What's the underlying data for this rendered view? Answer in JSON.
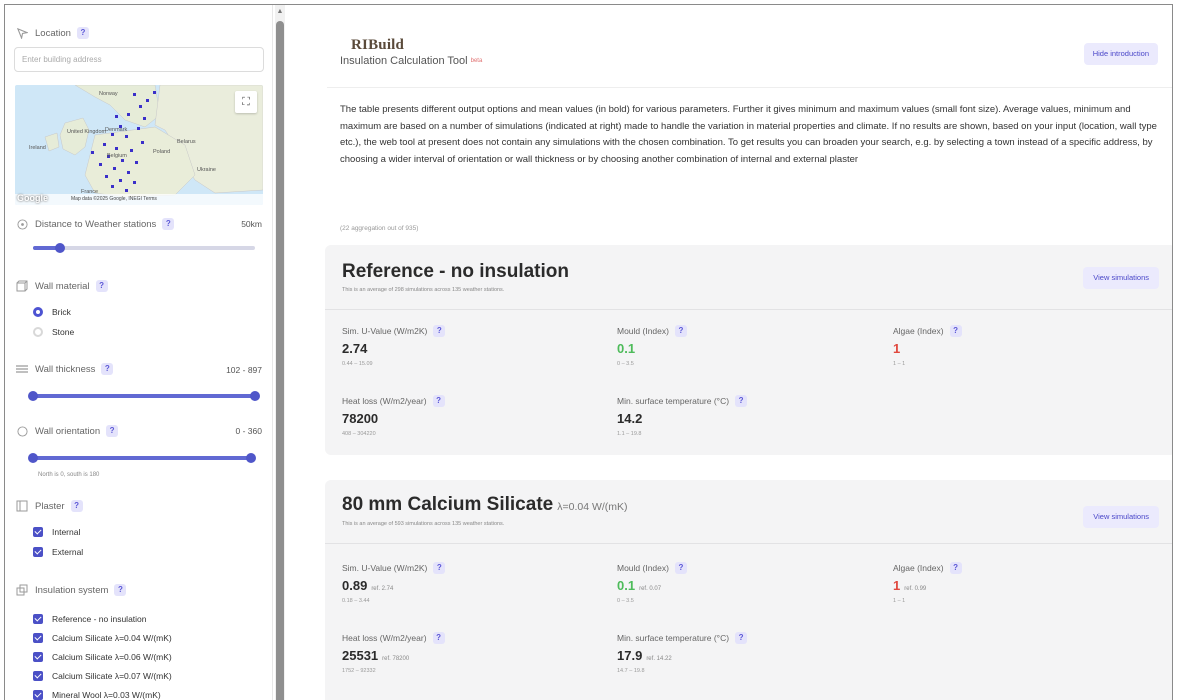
{
  "sidebar": {
    "location": {
      "label": "Location",
      "help": "?",
      "placeholder": "Enter building address"
    },
    "map": {
      "attribution": "Map data ©2025 Google, INEGI   Terms",
      "google": "Google",
      "labels": [
        "Norway",
        "United Kingdom",
        "Ireland",
        "Denmark",
        "Poland",
        "Belarus",
        "Ukraine",
        "France",
        "Belgium"
      ]
    },
    "distance": {
      "label": "Distance to Weather stations",
      "help": "?",
      "value": "50km",
      "fraction": 0.12
    },
    "wall_material": {
      "label": "Wall material",
      "help": "?",
      "options": [
        {
          "label": "Brick",
          "selected": true
        },
        {
          "label": "Stone",
          "selected": false
        }
      ]
    },
    "wall_thickness": {
      "label": "Wall thickness",
      "help": "?",
      "value": "102 - 897",
      "min_fraction": 0.0,
      "max_fraction": 1.0
    },
    "wall_orientation": {
      "label": "Wall orientation",
      "help": "?",
      "value": "0 - 360",
      "hint": "North is 0, south is 180",
      "min_fraction": 0.0,
      "max_fraction": 1.0
    },
    "plaster": {
      "label": "Plaster",
      "help": "?",
      "options": [
        {
          "label": "Internal"
        },
        {
          "label": "External"
        }
      ]
    },
    "insulation": {
      "label": "Insulation system",
      "help": "?",
      "options": [
        {
          "label": "Reference - no insulation"
        },
        {
          "label": "Calcium Silicate λ=0.04 W/(mK)"
        },
        {
          "label": "Calcium Silicate λ=0.06 W/(mK)"
        },
        {
          "label": "Calcium Silicate λ=0.07 W/(mK)"
        },
        {
          "label": "Mineral Wool λ=0.03 W/(mK)"
        }
      ]
    }
  },
  "header": {
    "logo": "RIBuild",
    "title": "Insulation Calculation Tool",
    "beta": "beta",
    "hide_intro": "Hide introduction"
  },
  "intro_text": "The table presents different output options and mean values (in bold) for various parameters. Further it gives minimum and maximum values (small font size). Average values, minimum and maximum are based on a number of simulations (indicated at right) made to handle the variation in material properties and climate. If no results are shown, based on your input (location, wall type etc.), the web tool at present does not contain any simulations with the chosen combination. To get results you can broaden your search, e.g. by selecting a town instead of a specific address, by choosing a wider interval of orientation or wall thickness or by choosing another combination of internal and external plaster",
  "aggregation": "(22 aggregation out of 935)",
  "cards": [
    {
      "title": "Reference - no insulation",
      "lambda": "",
      "subtitle": "This is an average of 298 simulations across 135 weather stations.",
      "button": "View simulations",
      "metrics": [
        {
          "label": "Sim. U-Value (W/m2K)",
          "value": "2.74",
          "ref": "",
          "range": "0.44 – 15.09",
          "color": "default"
        },
        {
          "label": "Mould (Index)",
          "value": "0.1",
          "ref": "",
          "range": "0 – 3.5",
          "color": "green"
        },
        {
          "label": "Algae (Index)",
          "value": "1",
          "ref": "",
          "range": "1 – 1",
          "color": "red"
        },
        {
          "label": "Heat loss (W/m2/year)",
          "value": "78200",
          "ref": "",
          "range": "408 – 304220",
          "color": "default"
        },
        {
          "label": "Min. surface temperature (°C)",
          "value": "14.2",
          "ref": "",
          "range": "1.1 – 19.8",
          "color": "default"
        }
      ]
    },
    {
      "title": "80 mm Calcium Silicate",
      "lambda": "λ=0.04 W/(mK)",
      "subtitle": "This is an average of 593 simulations across 135 weather stations.",
      "button": "View simulations",
      "metrics": [
        {
          "label": "Sim. U-Value (W/m2K)",
          "value": "0.89",
          "ref": "ref. 2.74",
          "range": "0.18 – 3.44",
          "color": "default"
        },
        {
          "label": "Mould (Index)",
          "value": "0.1",
          "ref": "ref. 0.07",
          "range": "0 – 3.5",
          "color": "green"
        },
        {
          "label": "Algae (Index)",
          "value": "1",
          "ref": "ref. 0.99",
          "range": "1 – 1",
          "color": "red"
        },
        {
          "label": "Heat loss (W/m2/year)",
          "value": "25531",
          "ref": "ref. 78200",
          "range": "1752 – 92332",
          "color": "default"
        },
        {
          "label": "Min. surface temperature (°C)",
          "value": "17.9",
          "ref": "ref. 14.22",
          "range": "14.7 – 19.8",
          "color": "default"
        }
      ]
    }
  ],
  "colors": {
    "accent": "#4f56c9",
    "green": "#4dbb5a",
    "red": "#e0483e"
  }
}
